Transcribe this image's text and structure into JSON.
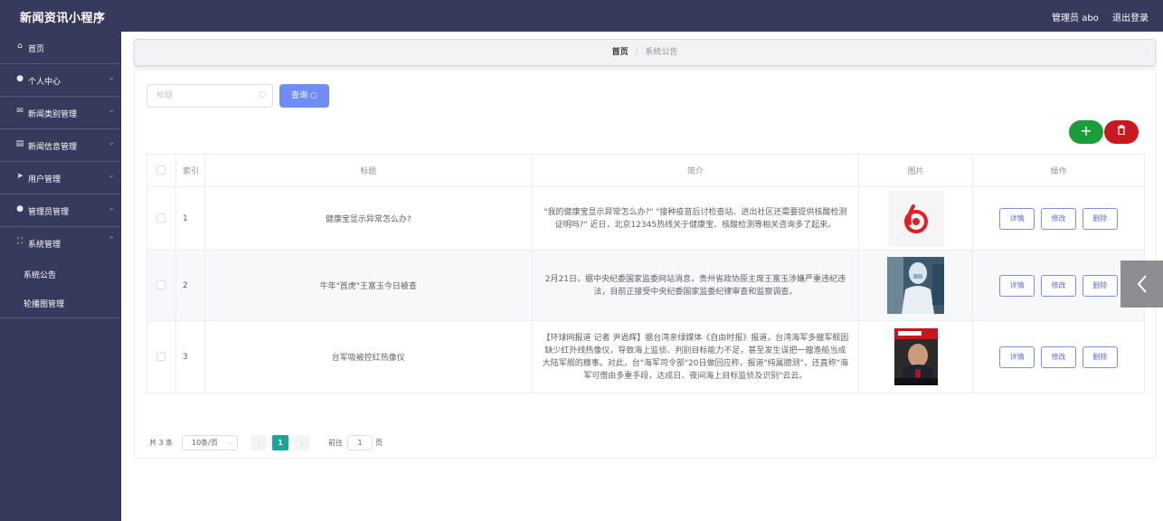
{
  "app": {
    "title": "新闻资讯小程序"
  },
  "header": {
    "user": "管理员 abo",
    "logout": "退出登录"
  },
  "sidebar": {
    "items": [
      {
        "icon": "home-icon",
        "label": "首页"
      },
      {
        "icon": "user-icon",
        "label": "个人中心"
      },
      {
        "icon": "mail-icon",
        "label": "新闻类别管理"
      },
      {
        "icon": "document-icon",
        "label": "新闻信息管理"
      },
      {
        "icon": "send-icon",
        "label": "用户管理"
      },
      {
        "icon": "admin-icon",
        "label": "管理员管理"
      },
      {
        "icon": "system-icon",
        "label": "系统管理"
      }
    ],
    "subitems": [
      {
        "label": "系统公告"
      },
      {
        "label": "轮播图管理"
      }
    ]
  },
  "breadcrumb": {
    "home": "首页",
    "separator": "/",
    "current": "系统公告"
  },
  "search": {
    "placeholder": "标题",
    "button": "查询"
  },
  "actions": {
    "add_icon": "plus-icon",
    "delete_icon": "trash-icon"
  },
  "table": {
    "headers": {
      "index": "索引",
      "title": "标题",
      "intro": "简介",
      "image": "图片",
      "ops": "操作"
    },
    "rows": [
      {
        "index": "1",
        "title": "健康宝显示异常怎么办?",
        "intro": "\"我的健康宝显示异常怎么办?\" \"接种疫苗后讨检查站、进出社区还需要提供核酸检测证明吗?\" 近日，北京12345热线关于健康宝、核酸检测等相关咨询多了起来。",
        "image": "netease-logo"
      },
      {
        "index": "2",
        "title": "牛年\"首虎\"王富玉今日被查",
        "intro": "2月21日，据中央纪委国家监委网站消息，贵州省政协原主席王富玉涉嫌严重违纪违法，目前正接受中央纪委国家监委纪律审查和监察调查。",
        "image": "protective-suit-photo"
      },
      {
        "index": "3",
        "title": "台军吸被控红热像仪",
        "intro": "【环球网报道 记者 尹過辉】据台湾亲绿媒体《自由时报》报道，台湾海军多艘军舰因缺少红外线热像仪，导致海上监侦、判别目标能力不足，甚至发生误把一艘渔船当成大陆军舰的糗事。对此，台\"海军司令部\"20日做回应称，报道\"纯属臆测\"，还直称\"海军可借由多重手段，达成日、夜间海上目标监侦及识别\"云云。",
        "image": "magazine-cover"
      }
    ],
    "row_buttons": {
      "detail": "详情",
      "edit": "修改",
      "delete": "删除"
    }
  },
  "pagination": {
    "total": "共 3 条",
    "page_size": "10条/页",
    "current_page": "1",
    "goto_label": "前往",
    "goto_value": "1",
    "page_suffix": "页"
  },
  "side_arrow": {
    "icon": "chevron-left-icon"
  }
}
